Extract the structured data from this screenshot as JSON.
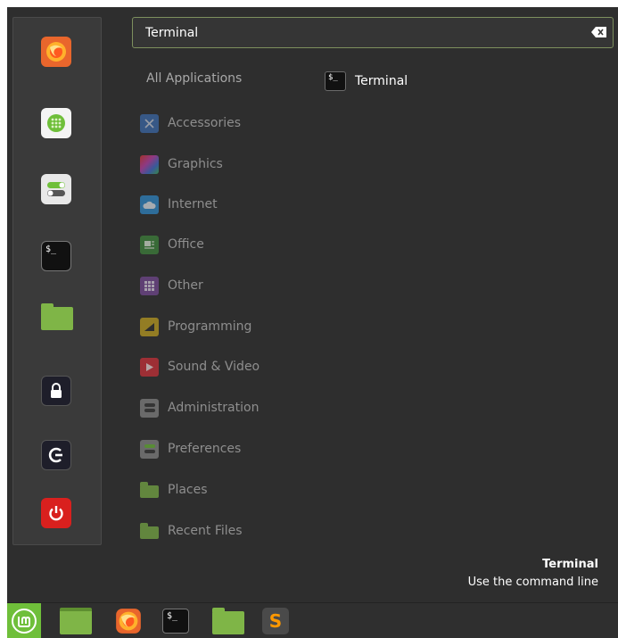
{
  "search": {
    "value": "Terminal",
    "clear_icon": "backspace-clear-icon"
  },
  "favorites": [
    {
      "name": "firefox",
      "icon": "firefox-icon"
    },
    {
      "name": "software-manager",
      "icon": "software-manager-icon"
    },
    {
      "name": "system-settings",
      "icon": "settings-toggle-icon"
    },
    {
      "name": "terminal",
      "icon": "terminal-icon",
      "glyph": "$_"
    },
    {
      "name": "files",
      "icon": "folder-icon"
    },
    {
      "name": "lock-screen",
      "icon": "lock-icon"
    },
    {
      "name": "logout",
      "icon": "logout-icon"
    },
    {
      "name": "quit",
      "icon": "power-icon"
    }
  ],
  "categories": {
    "all_label": "All Applications",
    "items": [
      {
        "label": "Accessories",
        "icon": "accessories-icon",
        "color": "#3d6fb5"
      },
      {
        "label": "Graphics",
        "icon": "graphics-icon",
        "color": "#c23fb0"
      },
      {
        "label": "Internet",
        "icon": "internet-icon",
        "color": "#2f8fd5"
      },
      {
        "label": "Office",
        "icon": "office-icon",
        "color": "#3f8a3d"
      },
      {
        "label": "Other",
        "icon": "other-icon",
        "color": "#7a4a9a"
      },
      {
        "label": "Programming",
        "icon": "programming-icon",
        "color": "#c9a81f"
      },
      {
        "label": "Sound & Video",
        "icon": "sound-video-icon",
        "color": "#d9303a"
      },
      {
        "label": "Administration",
        "icon": "administration-icon",
        "color": "#8a8a8a"
      },
      {
        "label": "Preferences",
        "icon": "preferences-icon",
        "color": "#8a8a8a"
      },
      {
        "label": "Places",
        "icon": "places-folder-icon",
        "color": "#7fb547"
      },
      {
        "label": "Recent Files",
        "icon": "recent-files-icon",
        "color": "#7fb547"
      }
    ]
  },
  "results": [
    {
      "label": "Terminal",
      "icon": "terminal-icon",
      "glyph": "$_"
    }
  ],
  "info": {
    "title": "Terminal",
    "description": "Use the command line"
  },
  "panel": {
    "items": [
      {
        "name": "mint-menu",
        "icon": "mint-logo-icon"
      },
      {
        "name": "show-desktop",
        "icon": "desktop-icon"
      },
      {
        "name": "firefox",
        "icon": "firefox-icon"
      },
      {
        "name": "terminal",
        "icon": "terminal-icon",
        "glyph": "$_"
      },
      {
        "name": "files",
        "icon": "folder-icon"
      },
      {
        "name": "sublime-text",
        "icon": "sublime-text-icon",
        "glyph": "S"
      }
    ]
  },
  "colors": {
    "accent": "#7fb547",
    "menu_bg": "#2e2e2e",
    "text_dim": "#8e8e8e"
  }
}
